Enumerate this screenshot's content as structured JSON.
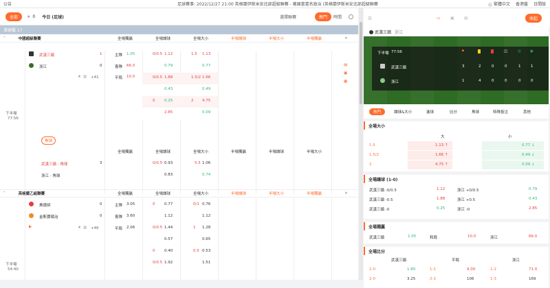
{
  "topbar": {
    "notice": "公告",
    "marquee": "足球賽事: 2022/12/27 21:00 英格蘭伊斯米安北部超級聯賽 - 萬國書書名政治 (英格蘭伊斯米安北部超級聯賽",
    "lang": "繁體中文",
    "region": "香港盤",
    "tz": "日間版"
  },
  "filter": {
    "all": "全部",
    "fav_count": "0",
    "title": "今日 (足球)",
    "sort": "選擇聯賽",
    "hot": "熱門",
    "time": "時間"
  },
  "bar2": {
    "label": "滾球盤 17"
  },
  "headers": {
    "full_handicap": "全場讓球",
    "full_ou": "全場大小",
    "full_1x2": "全場獨贏",
    "half_handicap": "半場讓球",
    "half_ou": "半場大小",
    "half_1x2": "半場獨贏",
    "full_1x2b": "全場獨贏",
    "full_handi2": "全場讓球",
    "full_ou2": "全場大小"
  },
  "league1": {
    "name": "中國超級聯賽",
    "home": "武漢三鎮",
    "away": "浙江",
    "home_score": "1",
    "away_score": "0",
    "more": "+41",
    "time_label": "下半場",
    "time": "77:56",
    "h_lab": "主隊",
    "h_val": "1.05",
    "a_lab": "客隊",
    "a_val": "66.0",
    "d_lab": "平局",
    "d_val": "10.0",
    "handicap": [
      [
        "0/0.5",
        "1.12",
        "1.5",
        "1.13"
      ],
      [
        "",
        "0.79",
        "",
        "0.77"
      ],
      [
        "0/0.5",
        "1.88",
        "1.5/2",
        "1.66"
      ],
      [
        "",
        "0.43",
        "",
        "0.49"
      ],
      [
        "0",
        "0.25",
        "2",
        "4.75"
      ],
      [
        "",
        "2.85",
        "",
        "0.09"
      ]
    ],
    "tag": "角球",
    "corner_home": "武漢三鎮 - 角球",
    "corner_away": "浙江 - 角球",
    "corner_hs": "3",
    "c_row1": [
      "0/0.5",
      "0.93",
      "5.5",
      "1.06"
    ],
    "c_row2": [
      "",
      "0.83",
      "",
      "0.74"
    ]
  },
  "league2": {
    "name": "英格蘭乙組聯賽",
    "home": "奧德拼",
    "away": "金斯寶頓治",
    "home_score": "0",
    "away_score": "0",
    "more": "+46",
    "time_label": "下半場",
    "time": "54:40",
    "h_lab": "主隊",
    "h_val": "3.05",
    "a_lab": "客隊",
    "a_val": "3.60",
    "d_lab": "平局",
    "d_val": "2.06",
    "rows": [
      [
        "0",
        "0.77",
        "0/1",
        "0.76"
      ],
      [
        "",
        "1.12",
        "",
        "1.12"
      ],
      [
        "0/0.5",
        "1.44",
        "1",
        "1.28"
      ],
      [
        "",
        "0.57",
        "",
        "0.65"
      ],
      [
        "0",
        "0.40",
        "0.5",
        "0.53"
      ],
      [
        "0/0.5",
        "1.92",
        "",
        "1.51"
      ]
    ]
  },
  "right": {
    "title": "武漢三鎮",
    "vs": "浙江",
    "collapse": "收起",
    "stats": {
      "period": "下半場",
      "clock": "77:56",
      "home": "武漢三鎮",
      "away": "浙江",
      "home_vals": [
        "3",
        "2",
        "0",
        "0",
        "1",
        "1"
      ],
      "away_vals": [
        "1",
        "4",
        "0",
        "0",
        "0",
        "0"
      ]
    },
    "tabs": [
      "熱門",
      "讓球&大小",
      "進球",
      "比分",
      "角球",
      "特殊投注",
      "其他"
    ],
    "ou": {
      "title": "全場大小",
      "over": "大",
      "under": "小",
      "rows": [
        [
          "1.5",
          "1.13",
          "0.77"
        ],
        [
          "1.5/2",
          "1.66",
          "0.49"
        ],
        [
          "2",
          "4.75",
          "0.09"
        ]
      ]
    },
    "hd": {
      "title": "全場讓球 (1-0)",
      "rows": [
        [
          "武漢三鎮 -0/0.5",
          "1.12",
          "浙江 +0/0.5",
          "0.79"
        ],
        [
          "武漢三鎮 -0.5",
          "1.88",
          "浙江 +0.5",
          "0.43"
        ],
        [
          "武漢三鎮 -0",
          "0.25",
          "浙江 -0",
          "2.85"
        ]
      ]
    },
    "x12": {
      "title": "全場獨贏",
      "home": "武漢三鎮",
      "hv": "1.05",
      "draw": "和局",
      "dv": "10.0",
      "away": "浙江",
      "av": "66.0"
    },
    "cs": {
      "title": "全場比分",
      "home": "武漢三鎮",
      "draw": "平局",
      "away": "浙江",
      "rows": [
        [
          "1-0",
          "1.80",
          "1-1",
          "9.00",
          "1-2",
          "71.0"
        ],
        [
          "2-0",
          "3.25",
          "2-2",
          "106",
          "1-3",
          "169"
        ]
      ]
    }
  }
}
